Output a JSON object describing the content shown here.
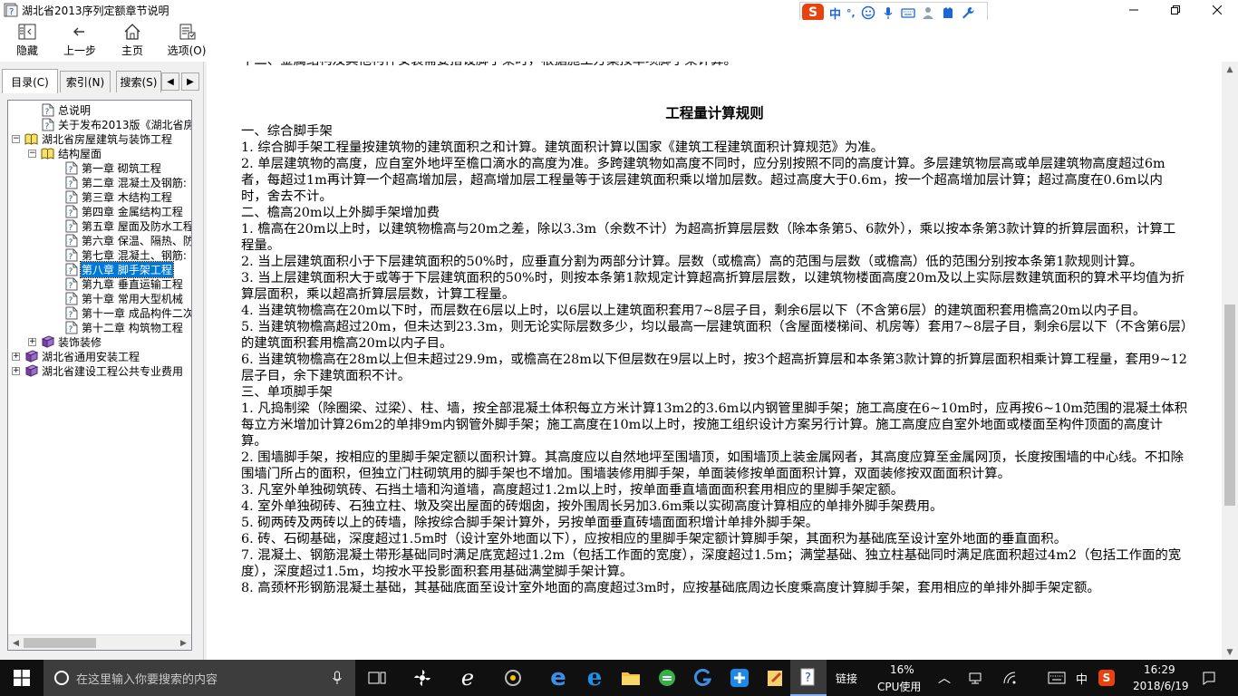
{
  "window": {
    "title": "湖北省2013序列定额章节说明",
    "minimize_icon": "minimize-icon",
    "maximize_icon": "restore-icon",
    "close_icon": "close-icon"
  },
  "ime": {
    "logo": "S",
    "mode": "中",
    "punct": "°,"
  },
  "toolbar": {
    "hide": "隐藏",
    "back": "上一步",
    "home": "主页",
    "options": "选项(O)"
  },
  "nav": {
    "tabs": [
      "目录(C)",
      "索引(N)",
      "搜索(S)"
    ],
    "tree": [
      {
        "label": "总说明",
        "level": 2,
        "icon": "help-page"
      },
      {
        "label": "关于发布2013版《湖北省房屋",
        "level": 2,
        "icon": "help-page"
      },
      {
        "label": "湖北省房屋建筑与装饰工程",
        "level": 1,
        "icon": "book-open",
        "expander": "−"
      },
      {
        "label": "结构屋面",
        "level": 2,
        "icon": "book-open",
        "expander": "−"
      },
      {
        "label": "第一章 砌筑工程",
        "level": 3,
        "icon": "help-page"
      },
      {
        "label": "第二章 混凝土及钢筋:",
        "level": 3,
        "icon": "help-page"
      },
      {
        "label": "第三章 木结构工程",
        "level": 3,
        "icon": "help-page"
      },
      {
        "label": "第四章 金属结构工程",
        "level": 3,
        "icon": "help-page"
      },
      {
        "label": "第五章 屋面及防水工程",
        "level": 3,
        "icon": "help-page"
      },
      {
        "label": "第六章 保温、隔热、防",
        "level": 3,
        "icon": "help-page"
      },
      {
        "label": "第七章 混凝土、钢筋:",
        "level": 3,
        "icon": "help-page"
      },
      {
        "label": "第八章 脚手架工程",
        "level": 3,
        "icon": "help-page",
        "selected": true
      },
      {
        "label": "第九章 垂直运输工程",
        "level": 3,
        "icon": "help-page"
      },
      {
        "label": "第十章 常用大型机械",
        "level": 3,
        "icon": "help-page"
      },
      {
        "label": "第十一章 成品构件二次",
        "level": 3,
        "icon": "help-page"
      },
      {
        "label": "第十二章 构筑物工程",
        "level": 3,
        "icon": "help-page"
      },
      {
        "label": "装饰装修",
        "level": 2,
        "icon": "book-closed",
        "expander": "+"
      },
      {
        "label": "湖北省通用安装工程",
        "level": 1,
        "icon": "book-closed",
        "expander": "+"
      },
      {
        "label": "湖北省建设工程公共专业费用",
        "level": 1,
        "icon": "book-closed",
        "expander": "+"
      }
    ]
  },
  "content": {
    "cut_line": "十二、金属结构及其他构件安装需要搭设脚手架时，根据施工方案按单项脚手架计算。",
    "heading": "工程量计算规则",
    "paragraphs": [
      "一、综合脚手架",
      "1. 综合脚手架工程量按建筑物的建筑面积之和计算。建筑面积计算以国家《建筑工程建筑面积计算规范》为准。",
      "2. 单层建筑物的高度，应自室外地坪至檐口滴水的高度为准。多跨建筑物如高度不同时，应分别按照不同的高度计算。多层建筑物层高或单层建筑物高度超过6m者，每超过1m再计算一个超高增加层，超高增加层工程量等于该层建筑面积乘以增加层数。超过高度大于0.6m，按一个超高增加层计算；超过高度在0.6m以内时，舍去不计。",
      "二、檐高20m以上外脚手架增加费",
      "1. 檐高在20m以上时，以建筑物檐高与20m之差，除以3.3m（余数不计）为超高折算层层数（除本条第5、6款外），乘以按本条第3款计算的折算层面积，计算工程量。",
      "2. 当上层建筑面积小于下层建筑面积的50%时，应垂直分割为两部分计算。层数（或檐高）高的范围与层数（或檐高）低的范围分别按本条第1款规则计算。",
      "3. 当上层建筑面积大于或等于下层建筑面积的50%时，则按本条第1款规定计算超高折算层层数，以建筑物楼面高度20m及以上实际层数建筑面积的算术平均值为折算层面积，乘以超高折算层层数，计算工程量。",
      "4. 当建筑物檐高在20m以下时，而层数在6层以上时，以6层以上建筑面积套用7~8层子目，剩余6层以下（不含第6层）的建筑面积套用檐高20m以内子目。",
      "5. 当建筑物檐高超过20m，但未达到23.3m，则无论实际层数多少，均以最高一层建筑面积（含屋面楼梯间、机房等）套用7~8层子目，剩余6层以下（不含第6层）的建筑面积套用檐高20m以内子目。",
      "6. 当建筑物檐高在28m以上但未超过29.9m，或檐高在28m以下但层数在9层以上时，按3个超高折算层和本条第3款计算的折算层面积相乘计算工程量，套用9~12层子目，余下建筑面积不计。",
      "三、单项脚手架",
      "1. 凡捣制梁（除圈梁、过梁）、柱、墙，按全部混凝土体积每立方米计算13m2的3.6m以内钢管里脚手架；施工高度在6~10m时，应再按6~10m范围的混凝土体积每立方米增加计算26m2的单排9m内钢管外脚手架；施工高度在10m以上时，按施工组织设计方案另行计算。施工高度应自室外地面或楼面至构件顶面的高度计算。",
      "2. 围墙脚手架，按相应的里脚手架定额以面积计算。其高度应以自然地坪至围墙顶，如围墙顶上装金属网者，其高度应算至金属网顶，长度按围墙的中心线。不扣除围墙门所占的面积，但独立门柱砌筑用的脚手架也不增加。围墙装修用脚手架，单面装修按单面面积计算，双面装修按双面面积计算。",
      "3. 凡室外单独砌筑砖、石挡土墙和沟道墙，高度超过1.2m以上时，按单面垂直墙面面积套用相应的里脚手架定额。",
      "4. 室外单独砌砖、石独立柱、墩及突出屋面的砖烟囱，按外围周长另加3.6m乘以实砌高度计算相应的单排外脚手架费用。",
      "5. 砌两砖及两砖以上的砖墙，除按综合脚手架计算外，另按单面垂直砖墙面面积增计单排外脚手架。",
      "6. 砖、石砌基础，深度超过1.5m时（设计室外地面以下），应按相应的里脚手架定额计算脚手架，其面积为基础底至设计室外地面的垂直面积。",
      "7. 混凝土、钢筋混凝土带形基础同时满足底宽超过1.2m（包括工作面的宽度），深度超过1.5m；满堂基础、独立柱基础同时满足底面积超过4m2（包括工作面的宽度），深度超过1.5m，均按水平投影面积套用基础满堂脚手架计算。",
      "8. 高颈杯形钢筋混凝土基础，其基础底面至设计室外地面的高度超过3m时，应按基础底周边长度乘高度计算脚手架，套用相应的单排外脚手架定额。"
    ]
  },
  "taskbar": {
    "search_placeholder": "在这里输入你要搜索的内容",
    "link_label": "链接",
    "cpu_percent": "16%",
    "cpu_label": "CPU使用",
    "ime_lang": "中",
    "time": "16:29",
    "date": "2018/6/19"
  }
}
